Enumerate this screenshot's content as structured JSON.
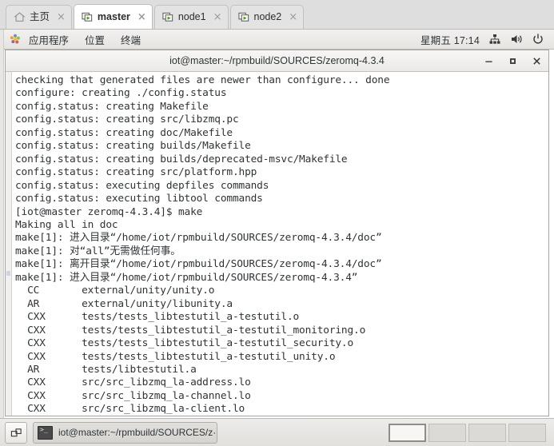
{
  "tabstrip": {
    "tabs": [
      {
        "label": "主页",
        "icon": "home-icon",
        "active": false,
        "close": "×"
      },
      {
        "label": "master",
        "icon": "remote-desktop-icon",
        "active": true,
        "close": "×"
      },
      {
        "label": "node1",
        "icon": "remote-desktop-icon",
        "active": false,
        "close": "×"
      },
      {
        "label": "node2",
        "icon": "remote-desktop-icon",
        "active": false,
        "close": "×"
      }
    ]
  },
  "panel": {
    "menus": [
      "应用程序",
      "位置",
      "终端"
    ],
    "logo_icon": "gnome-foot-icon",
    "clock": "星期五 17:14",
    "tray": [
      "network-icon",
      "volume-icon",
      "power-icon"
    ]
  },
  "window": {
    "title": "iot@master:~/rpmbuild/SOURCES/zeromq-4.3.4",
    "buttons": {
      "minimize": "–",
      "maximize": "□",
      "close": "×"
    }
  },
  "terminal": {
    "lines": [
      "checking that generated files are newer than configure... done",
      "configure: creating ./config.status",
      "config.status: creating Makefile",
      "config.status: creating src/libzmq.pc",
      "config.status: creating doc/Makefile",
      "config.status: creating builds/Makefile",
      "config.status: creating builds/deprecated-msvc/Makefile",
      "config.status: creating src/platform.hpp",
      "config.status: executing depfiles commands",
      "config.status: executing libtool commands",
      "[iot@master zeromq-4.3.4]$ make",
      "Making all in doc",
      "make[1]: 进入目录“/home/iot/rpmbuild/SOURCES/zeromq-4.3.4/doc”",
      "make[1]: 对“all”无需做任何事。",
      "make[1]: 离开目录“/home/iot/rpmbuild/SOURCES/zeromq-4.3.4/doc”",
      "make[1]: 进入目录“/home/iot/rpmbuild/SOURCES/zeromq-4.3.4”",
      "  CC       external/unity/unity.o",
      "  AR       external/unity/libunity.a",
      "  CXX      tests/tests_libtestutil_a-testutil.o",
      "  CXX      tests/tests_libtestutil_a-testutil_monitoring.o",
      "  CXX      tests/tests_libtestutil_a-testutil_security.o",
      "  CXX      tests/tests_libtestutil_a-testutil_unity.o",
      "  AR       tests/libtestutil.a",
      "  CXX      src/src_libzmq_la-address.lo",
      "  CXX      src/src_libzmq_la-channel.lo",
      "  CXX      src/src_libzmq_la-client.lo"
    ],
    "cursor": "block"
  },
  "taskbar": {
    "show_desktop_icon": "show-desktop-icon",
    "task_icon": "terminal-icon",
    "task_label": "iot@master:~/rpmbuild/SOURCES/z···",
    "workspaces": [
      {
        "active": true
      },
      {
        "active": false
      },
      {
        "active": false
      },
      {
        "active": false
      }
    ]
  },
  "colors": {
    "panel_bg": "#eceae8",
    "tab_active_bg": "#ffffff",
    "terminal_bg": "#ffffff",
    "terminal_fg": "#2f3336",
    "accent_green": "#4e9a06"
  }
}
